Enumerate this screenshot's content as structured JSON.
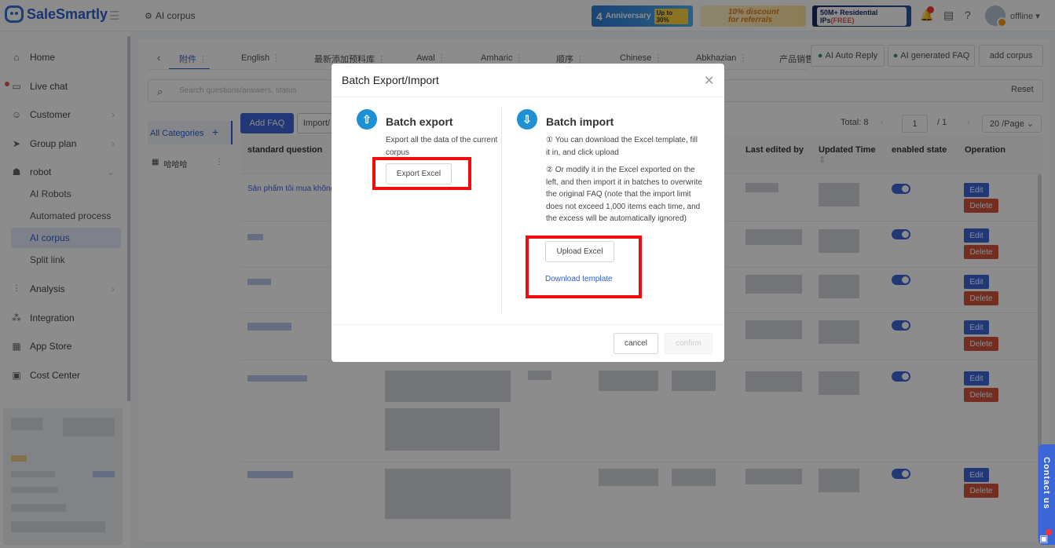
{
  "app": {
    "brand": "SaleSmartly",
    "breadcrumb": "AI corpus",
    "status": "offline",
    "banners": {
      "anniversary": "Anniversary",
      "anniversary_num": "4",
      "anniversary_tag": "Up to 30%",
      "discount_line1": "10% discount",
      "discount_line2": "for referrals",
      "ips": "50M+ Residential IPs",
      "ips_free": "(FREE)"
    }
  },
  "sidebar": {
    "items": [
      {
        "label": "Home",
        "icon": "home-icon"
      },
      {
        "label": "Live chat",
        "icon": "chat-icon"
      },
      {
        "label": "Customer",
        "icon": "customer-icon"
      },
      {
        "label": "Group plan",
        "icon": "send-icon"
      },
      {
        "label": "robot",
        "icon": "robot-icon"
      },
      {
        "label": "Analysis",
        "icon": "analysis-icon"
      },
      {
        "label": "Integration",
        "icon": "integration-icon"
      },
      {
        "label": "App Store",
        "icon": "apps-icon"
      },
      {
        "label": "Cost Center",
        "icon": "wallet-icon"
      }
    ],
    "robot_sub": [
      "AI Robots",
      "Automated process",
      "AI corpus",
      "Split link"
    ]
  },
  "tabs": [
    "附件",
    "English",
    "最新添加预料库",
    "Awal",
    "Amharic",
    "顺序",
    "Chinese",
    "Abkhazian",
    "产品销售"
  ],
  "tab_buttons": {
    "auto_reply": "AI Auto Reply",
    "generated_faq": "AI generated FAQ",
    "add_corpus": "add corpus"
  },
  "search": {
    "placeholder": "Search questions/answers, status",
    "reset": "Reset"
  },
  "categories": {
    "all": "All Categories",
    "item": "哈哈哈"
  },
  "toolbar": {
    "add_faq": "Add FAQ",
    "import": "Import/"
  },
  "pagination": {
    "total": "Total:  8",
    "page": "1",
    "of": "/ 1",
    "per_page": "20 /Page"
  },
  "table": {
    "headers": [
      "standard question",
      "Last edited by",
      "Updated Time",
      "enabled state",
      "Operation"
    ],
    "first_question": "Sản phẩm tôi mua không",
    "edit": "Edit",
    "delete": "Delete"
  },
  "dialog": {
    "title": "Batch Export/Import",
    "export": {
      "title": "Batch export",
      "desc": "Export all the data of the current corpus",
      "button": "Export Excel"
    },
    "import": {
      "title": "Batch import",
      "step1": "① You can download the Excel template, fill it in, and click upload",
      "step2": "② Or modify it in the Excel exported on the left, and then import it in batches to overwrite the original FAQ (note that the import limit does not exceed 1,000 items each time, and the excess will be automatically ignored)",
      "upload": "Upload Excel",
      "download": "Download template"
    },
    "cancel": "cancel",
    "confirm": "confirm"
  },
  "contact": "Contact us"
}
